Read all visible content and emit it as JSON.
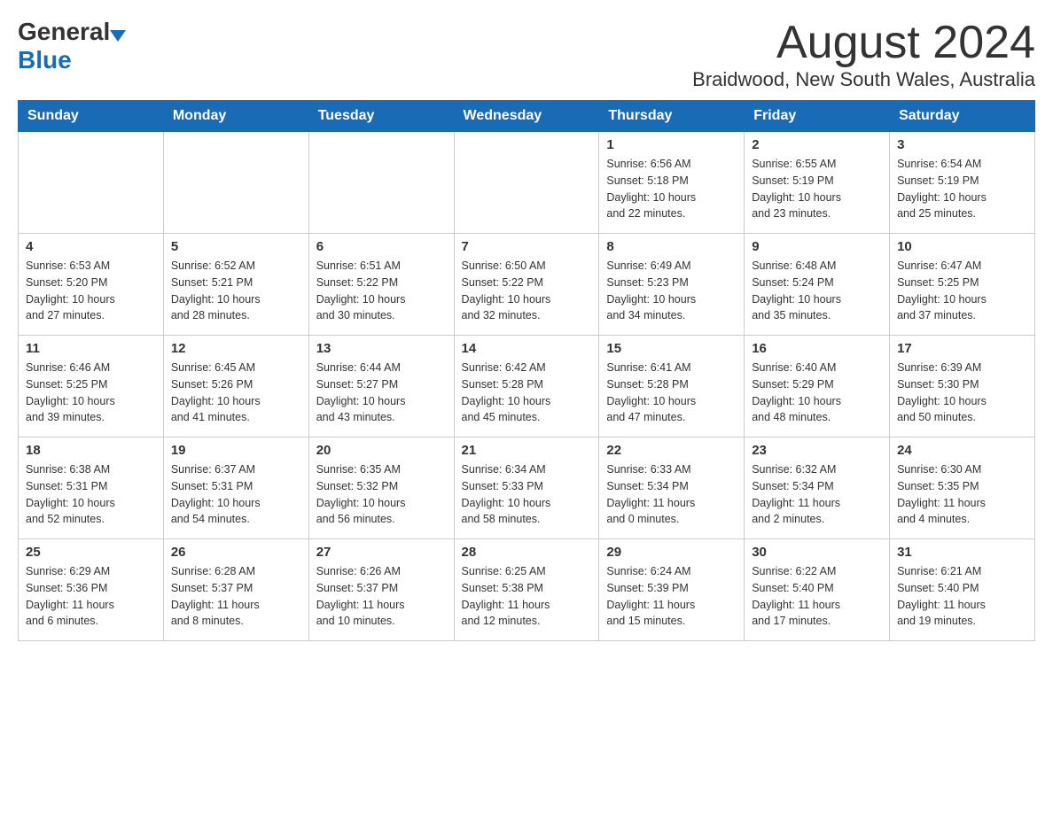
{
  "header": {
    "logo_general": "General",
    "logo_blue": "Blue",
    "month_title": "August 2024",
    "location": "Braidwood, New South Wales, Australia"
  },
  "days_of_week": [
    "Sunday",
    "Monday",
    "Tuesday",
    "Wednesday",
    "Thursday",
    "Friday",
    "Saturday"
  ],
  "weeks": [
    [
      {
        "day": "",
        "info": ""
      },
      {
        "day": "",
        "info": ""
      },
      {
        "day": "",
        "info": ""
      },
      {
        "day": "",
        "info": ""
      },
      {
        "day": "1",
        "info": "Sunrise: 6:56 AM\nSunset: 5:18 PM\nDaylight: 10 hours\nand 22 minutes."
      },
      {
        "day": "2",
        "info": "Sunrise: 6:55 AM\nSunset: 5:19 PM\nDaylight: 10 hours\nand 23 minutes."
      },
      {
        "day": "3",
        "info": "Sunrise: 6:54 AM\nSunset: 5:19 PM\nDaylight: 10 hours\nand 25 minutes."
      }
    ],
    [
      {
        "day": "4",
        "info": "Sunrise: 6:53 AM\nSunset: 5:20 PM\nDaylight: 10 hours\nand 27 minutes."
      },
      {
        "day": "5",
        "info": "Sunrise: 6:52 AM\nSunset: 5:21 PM\nDaylight: 10 hours\nand 28 minutes."
      },
      {
        "day": "6",
        "info": "Sunrise: 6:51 AM\nSunset: 5:22 PM\nDaylight: 10 hours\nand 30 minutes."
      },
      {
        "day": "7",
        "info": "Sunrise: 6:50 AM\nSunset: 5:22 PM\nDaylight: 10 hours\nand 32 minutes."
      },
      {
        "day": "8",
        "info": "Sunrise: 6:49 AM\nSunset: 5:23 PM\nDaylight: 10 hours\nand 34 minutes."
      },
      {
        "day": "9",
        "info": "Sunrise: 6:48 AM\nSunset: 5:24 PM\nDaylight: 10 hours\nand 35 minutes."
      },
      {
        "day": "10",
        "info": "Sunrise: 6:47 AM\nSunset: 5:25 PM\nDaylight: 10 hours\nand 37 minutes."
      }
    ],
    [
      {
        "day": "11",
        "info": "Sunrise: 6:46 AM\nSunset: 5:25 PM\nDaylight: 10 hours\nand 39 minutes."
      },
      {
        "day": "12",
        "info": "Sunrise: 6:45 AM\nSunset: 5:26 PM\nDaylight: 10 hours\nand 41 minutes."
      },
      {
        "day": "13",
        "info": "Sunrise: 6:44 AM\nSunset: 5:27 PM\nDaylight: 10 hours\nand 43 minutes."
      },
      {
        "day": "14",
        "info": "Sunrise: 6:42 AM\nSunset: 5:28 PM\nDaylight: 10 hours\nand 45 minutes."
      },
      {
        "day": "15",
        "info": "Sunrise: 6:41 AM\nSunset: 5:28 PM\nDaylight: 10 hours\nand 47 minutes."
      },
      {
        "day": "16",
        "info": "Sunrise: 6:40 AM\nSunset: 5:29 PM\nDaylight: 10 hours\nand 48 minutes."
      },
      {
        "day": "17",
        "info": "Sunrise: 6:39 AM\nSunset: 5:30 PM\nDaylight: 10 hours\nand 50 minutes."
      }
    ],
    [
      {
        "day": "18",
        "info": "Sunrise: 6:38 AM\nSunset: 5:31 PM\nDaylight: 10 hours\nand 52 minutes."
      },
      {
        "day": "19",
        "info": "Sunrise: 6:37 AM\nSunset: 5:31 PM\nDaylight: 10 hours\nand 54 minutes."
      },
      {
        "day": "20",
        "info": "Sunrise: 6:35 AM\nSunset: 5:32 PM\nDaylight: 10 hours\nand 56 minutes."
      },
      {
        "day": "21",
        "info": "Sunrise: 6:34 AM\nSunset: 5:33 PM\nDaylight: 10 hours\nand 58 minutes."
      },
      {
        "day": "22",
        "info": "Sunrise: 6:33 AM\nSunset: 5:34 PM\nDaylight: 11 hours\nand 0 minutes."
      },
      {
        "day": "23",
        "info": "Sunrise: 6:32 AM\nSunset: 5:34 PM\nDaylight: 11 hours\nand 2 minutes."
      },
      {
        "day": "24",
        "info": "Sunrise: 6:30 AM\nSunset: 5:35 PM\nDaylight: 11 hours\nand 4 minutes."
      }
    ],
    [
      {
        "day": "25",
        "info": "Sunrise: 6:29 AM\nSunset: 5:36 PM\nDaylight: 11 hours\nand 6 minutes."
      },
      {
        "day": "26",
        "info": "Sunrise: 6:28 AM\nSunset: 5:37 PM\nDaylight: 11 hours\nand 8 minutes."
      },
      {
        "day": "27",
        "info": "Sunrise: 6:26 AM\nSunset: 5:37 PM\nDaylight: 11 hours\nand 10 minutes."
      },
      {
        "day": "28",
        "info": "Sunrise: 6:25 AM\nSunset: 5:38 PM\nDaylight: 11 hours\nand 12 minutes."
      },
      {
        "day": "29",
        "info": "Sunrise: 6:24 AM\nSunset: 5:39 PM\nDaylight: 11 hours\nand 15 minutes."
      },
      {
        "day": "30",
        "info": "Sunrise: 6:22 AM\nSunset: 5:40 PM\nDaylight: 11 hours\nand 17 minutes."
      },
      {
        "day": "31",
        "info": "Sunrise: 6:21 AM\nSunset: 5:40 PM\nDaylight: 11 hours\nand 19 minutes."
      }
    ]
  ]
}
